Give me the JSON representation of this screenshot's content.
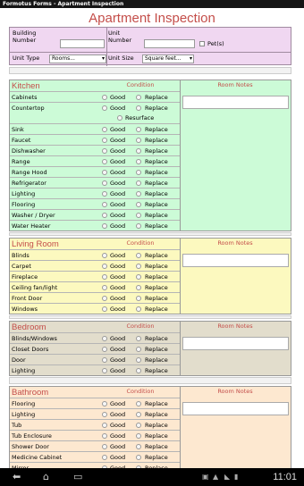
{
  "window": {
    "title": "Formotus Forms - Apartment Inspection"
  },
  "form": {
    "title": "Apartment Inspection",
    "building_number_label": "Building Number",
    "unit_number_label": "Unit Number",
    "pets_label": "Pet(s)",
    "unit_type_label": "Unit Type",
    "unit_type_value": "Rooms...",
    "unit_size_label": "Unit Size",
    "unit_size_value": "Square feet..."
  },
  "labels": {
    "condition": "Condition",
    "room_notes": "Room Notes",
    "good": "Good",
    "replace": "Replace",
    "resurface": "Resurface"
  },
  "sections": [
    {
      "name": "Kitchen",
      "color": "#ccfbd7",
      "items": [
        "Cabinets",
        "Countertop",
        "Sink",
        "Faucet",
        "Dishwasher",
        "Range",
        "Range Hood",
        "Refrigerator",
        "Lighting",
        "Flooring",
        "Washer / Dryer",
        "Water Heater"
      ]
    },
    {
      "name": "Living Room",
      "color": "#fcf9bf",
      "items": [
        "Blinds",
        "Carpet",
        "Fireplace",
        "Ceiling fan/light",
        "Front Door",
        "Windows"
      ]
    },
    {
      "name": "Bedroom",
      "color": "#e2ddcc",
      "items": [
        "Blinds/Windows",
        "Closet Doors",
        "Door",
        "Lighting"
      ]
    },
    {
      "name": "Bathroom",
      "color": "#fde8d0",
      "items": [
        "Flooring",
        "Lighting",
        "Tub",
        "Tub Enclosure",
        "Shower Door",
        "Medicine Cabinet",
        "Mirror"
      ]
    }
  ],
  "status": {
    "time": "11:01"
  },
  "icons": [
    "back-icon",
    "home-icon",
    "recent-apps-icon",
    "screenshot-icon",
    "wifi-icon",
    "battery-icon",
    "signal-icon"
  ]
}
